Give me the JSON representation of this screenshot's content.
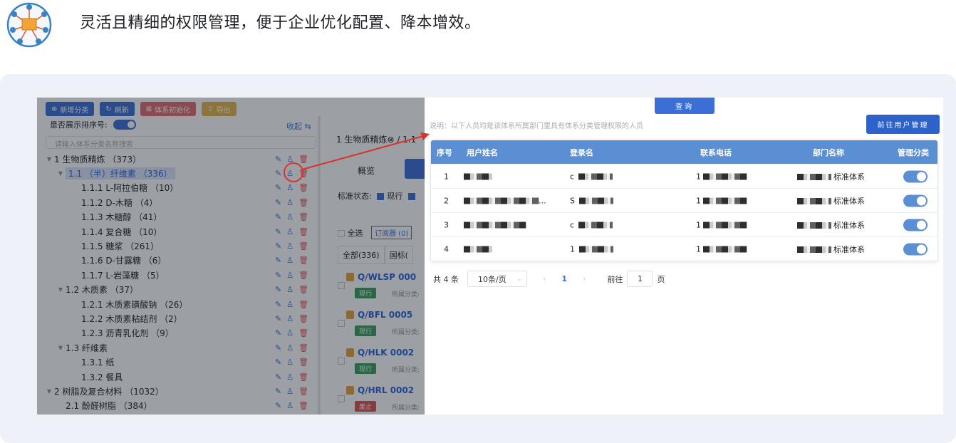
{
  "headline": "灵活且精细的权限管理，便于企业优化配置、降本增效。",
  "toolbar": {
    "add_category": "新增分类",
    "refresh": "刷新",
    "init_system": "体系初始化",
    "export": "导出"
  },
  "sort_label": "是否展示排序号:",
  "collapse_label": "收起",
  "tree_search_placeholder": "请输入体系分类名称搜索",
  "tree": [
    {
      "label": "1 生物质精炼 （373）",
      "level": 0,
      "caret": "▼"
    },
    {
      "label": "1.1 （半）纤维素 （336）",
      "level": 1,
      "caret": "▼",
      "selected": true
    },
    {
      "label": "1.1.1 L-阿拉伯糖 （10）",
      "level": 2
    },
    {
      "label": "1.1.2 D-木糖 （4）",
      "level": 2
    },
    {
      "label": "1.1.3 木糖醇 （41）",
      "level": 2
    },
    {
      "label": "1.1.4 复合糖 （10）",
      "level": 2
    },
    {
      "label": "1.1.5 糖浆 （261）",
      "level": 2
    },
    {
      "label": "1.1.6 D-甘露糖 （6）",
      "level": 2
    },
    {
      "label": "1.1.7 L-岩藻糖 （5）",
      "level": 2
    },
    {
      "label": "1.2 木质素 （37）",
      "level": 1,
      "caret": "▼"
    },
    {
      "label": "1.2.1 木质素磺酸钠 （26）",
      "level": 2
    },
    {
      "label": "1.2.2 木质素粘结剂 （2）",
      "level": 2
    },
    {
      "label": "1.2.3 沥青乳化剂 （9）",
      "level": 2
    },
    {
      "label": "1.3 纤维素",
      "level": 1,
      "caret": "▼"
    },
    {
      "label": "1.3.1 纸",
      "level": 2
    },
    {
      "label": "1.3.2 餐具",
      "level": 2
    },
    {
      "label": "2 树脂及复合材料 （1032）",
      "level": 0,
      "caret": "▼"
    },
    {
      "label": "2.1 酚醛树脂 （384）",
      "level": 1
    }
  ],
  "right_pane": {
    "title": "1 生物质精炼⊗ / 1.1",
    "tab_overview": "概览",
    "status_label": "标准状态:",
    "status_current": "现行",
    "select_all": "全选",
    "subscriber": "订阅器 (0)",
    "tab_all": "全部(336)",
    "tab_national": "国标(",
    "standards": [
      {
        "code": "Q/WLSP 000",
        "status": "现行",
        "meta": "所属分类:"
      },
      {
        "code": "Q/BFL 0005",
        "status": "现行",
        "meta": "所属分类:"
      },
      {
        "code": "Q/HLK 0002",
        "status": "现行",
        "meta": "所属分类:"
      },
      {
        "code": "Q/HRL 0002",
        "status": "废止",
        "meta": "所属分类:"
      }
    ]
  },
  "dialog": {
    "query_button": "查询",
    "note": "说明：以下人员均是该体系所属部门里具有体系分类管理权限的人员",
    "goto_user_button": "前往用户管理",
    "columns": [
      "序号",
      "用户姓名",
      "登录名",
      "联系电话",
      "部门名称",
      "管理分类"
    ],
    "rows": [
      {
        "index": "1",
        "name_suffix": "",
        "login_prefix": "c",
        "phone_prefix": "1",
        "dept": "标准体系",
        "managed": true
      },
      {
        "index": "2",
        "name_suffix": "...",
        "login_prefix": "S",
        "phone_prefix": "1",
        "dept": "标准体系",
        "managed": true
      },
      {
        "index": "3",
        "name_suffix": "",
        "login_prefix": "c",
        "phone_prefix": "1",
        "dept": "标准体系",
        "managed": true
      },
      {
        "index": "4",
        "name_suffix": "",
        "login_prefix": "1",
        "phone_prefix": "1",
        "dept": "标准体系",
        "managed": true
      }
    ],
    "pagination": {
      "total": "共 4 条",
      "page_size": "10条/页",
      "current_page": "1",
      "goto_label": "前往",
      "goto_value": "1",
      "page_unit": "页"
    }
  },
  "colors": {
    "primary": "#3c6fd6",
    "table_header": "#5b8fd4",
    "danger": "#d9534f",
    "success": "#3a9d5d",
    "annotation": "#d9342b"
  }
}
